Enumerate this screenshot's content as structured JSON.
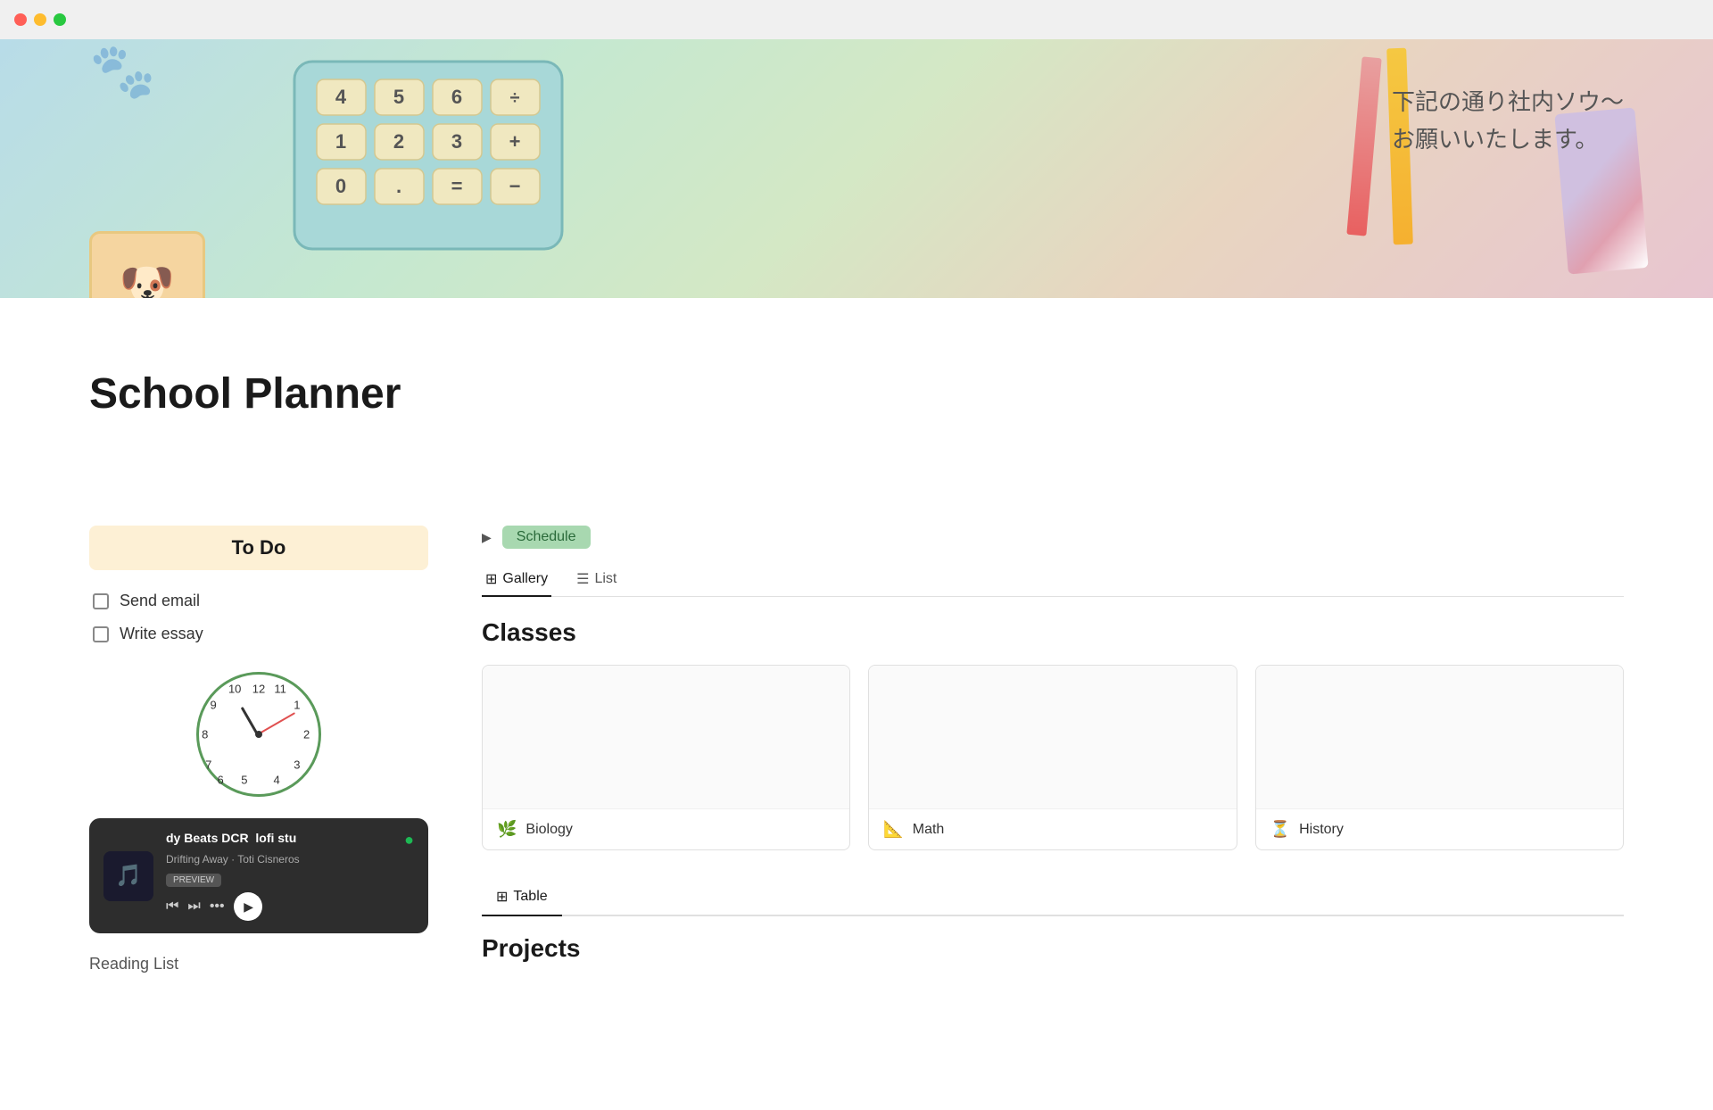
{
  "titlebar": {
    "buttons": [
      "close",
      "minimize",
      "maximize"
    ]
  },
  "banner": {
    "japanese_text_line1": "下記の通り社内ソウ〜",
    "japanese_text_line2": "お願いいたします。"
  },
  "page": {
    "title": "School Planner"
  },
  "todo": {
    "header": "To Do",
    "items": [
      {
        "label": "Send email",
        "checked": false
      },
      {
        "label": "Write essay",
        "checked": false
      }
    ]
  },
  "clock": {
    "numbers": [
      "12",
      "1",
      "2",
      "3",
      "4",
      "5",
      "6",
      "7",
      "8",
      "9",
      "10",
      "11"
    ]
  },
  "music": {
    "title": "dy Beats DCR",
    "title2": "lofi stu",
    "subtitle": "Drifting Away · Toti Cisneros",
    "preview_label": "PREVIEW",
    "thumbnail_emoji": "🎵"
  },
  "schedule": {
    "toggle_label": "▶",
    "badge_label": "Schedule"
  },
  "view_tabs": [
    {
      "icon": "⊞",
      "label": "Gallery",
      "active": true
    },
    {
      "icon": "☰",
      "label": "List",
      "active": false
    }
  ],
  "classes": {
    "section_title": "Classes",
    "items": [
      {
        "icon": "🌿",
        "name": "Biology",
        "color": "#4a9a5a"
      },
      {
        "icon": "📐",
        "name": "Math",
        "color": "#7a5a9a"
      },
      {
        "icon": "⏳",
        "name": "History",
        "color": "#c05a4a"
      }
    ]
  },
  "table_tabs": [
    {
      "icon": "⊞",
      "label": "Table",
      "active": true
    }
  ],
  "projects": {
    "section_title": "Projects"
  },
  "reading_list": {
    "label": "Reading List"
  }
}
